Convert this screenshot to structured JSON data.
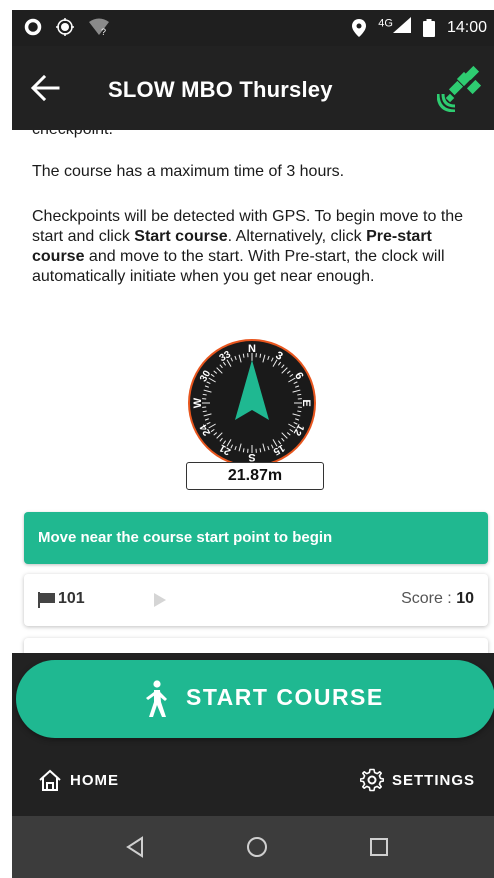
{
  "status_bar": {
    "network": "4G",
    "time": "14:00"
  },
  "app_bar": {
    "title": "SLOW MBO Thursley",
    "back_icon": "arrow-left-icon",
    "gps_icon": "satellite-signal-icon",
    "gps_color": "#2ecc71"
  },
  "instructions": {
    "partial_line": "checkpoint.",
    "max_time": "The course has a maximum time of 3 hours.",
    "p_a": "Checkpoints will be detected with GPS. To begin move to the start and click ",
    "start_course_bold": "Start course",
    "p_b": ". Alternatively, click ",
    "prestart_bold": "Pre-start course",
    "p_c": " and move to the start. With Pre-start, the clock will automatically initiate when you get near enough."
  },
  "compass": {
    "labels": [
      "N",
      "3",
      "6",
      "E",
      "12",
      "15",
      "S",
      "21",
      "24",
      "W",
      "30",
      "33"
    ],
    "bezel_color": "#1a1a1a",
    "rim_color": "#e8561e",
    "needle_color": "#1fb891"
  },
  "distance": "21.87m",
  "banner": {
    "text": "Move near the course start point to begin",
    "color": "#20b890"
  },
  "checkpoints": [
    {
      "id": "101",
      "score_label": "Score : ",
      "score": "10"
    }
  ],
  "start_button": {
    "label": "START COURSE",
    "color": "#1fb891"
  },
  "bottom_nav": {
    "home": "HOME",
    "settings": "SETTINGS"
  }
}
